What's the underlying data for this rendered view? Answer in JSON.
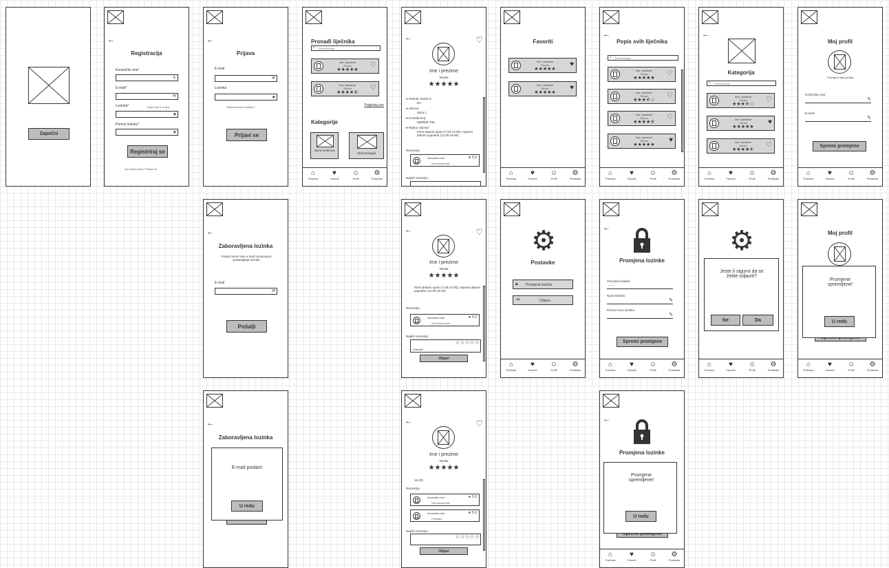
{
  "common": {
    "back": "←",
    "star5": "★★★★★",
    "star45": "★★★★⯪",
    "star35": "★★★⯪☆",
    "emptyStars": "☆☆☆☆☆",
    "heart_outline": "♡",
    "heart_filled": "♥",
    "pencil": "✎",
    "mail": "✉",
    "eye": "👁",
    "user_ic": "♙",
    "search_ic": "🔍",
    "tabs": [
      "Početna",
      "Favoriti",
      "Profil",
      "Postavke"
    ],
    "tab_icons": [
      "⌂",
      "♥",
      "☺",
      "⚙"
    ],
    "doctor_name": "Ime i prezime",
    "specialty": "Struka"
  },
  "s1": {
    "button": "Započni"
  },
  "s2": {
    "title": "Registracija",
    "username_label": "Korisničko ime*",
    "email_label": "E-mail*",
    "password_label": "Lozinka*",
    "password_hint": "Najmanje 8 znaka",
    "repeat_label": "Ponovi lozinku*",
    "button": "Registriraj se",
    "footer": "Već imaš račun? Prijavi se"
  },
  "s3": {
    "title": "Prijava",
    "email_label": "E-mail",
    "password_label": "Lozinka",
    "forgot": "Zaboravio/la si lozinku?",
    "button": "Prijavi se"
  },
  "s4": {
    "title": "Pronađi liječnika",
    "search_ph": "Pretraživanje",
    "see_all": "Pogledaj sve",
    "categories_title": "Kategorije",
    "cat1": "Opća medicina",
    "cat2": "Stomatologija"
  },
  "s5": {
    "b1": "Partner HZZO-a:",
    "b1v": "DA",
    "b2": "Adresa:",
    "b2v": "Ulica 1",
    "b3": "Kontakt broj:",
    "b3v": "053/506-708",
    "b4": "Radno vrijeme:",
    "b4v": "Parni datumi ujutro (7.00-14.00), neparni datumi popodne (14.00-19.00)",
    "reviews": "Recenzije:",
    "r_user": "korisničko ime",
    "r_rating": "5.0",
    "r_text": "Sve preporuke!",
    "write": "Napiši recenziju:"
  },
  "s6": {
    "title": "Favoriti"
  },
  "s7": {
    "title": "Popis svih liječnika",
    "search_ph": "Pretraživanje"
  },
  "s8": {
    "title": "Kategorija",
    "search_ph": "Pretraživanje"
  },
  "s9": {
    "title": "Moj profil",
    "change_photo": "Promijeni sliku profila",
    "username_label": "Korisničko ime:",
    "email_label": "E-mail:",
    "button": "Spremi promjene"
  },
  "s10": {
    "title": "Zaboravljena lozinka",
    "desc": "Poslat ćemo Vam e-mail za ponovno postavljanje lozinke",
    "email_label": "E-mail",
    "button": "Pošalji"
  },
  "s11": {
    "hours": "Parni datumi ujutro (7.00-14.00), neparni datumi popodne (14.00-19.00)",
    "reviews": "Recenzije:",
    "r_user": "korisničko ime",
    "r_rating": "5.0",
    "r_text": "Sve preporuke!",
    "write": "Napiši recenziju:",
    "write_ph": "Pohvale!",
    "post": "Objavi"
  },
  "s12": {
    "title": "Postavke",
    "change_pw": "Promjena lozinke",
    "logout": "Odjava"
  },
  "s13": {
    "title": "Promjena lozinke",
    "current": "Trenutna lozinka:",
    "current_val": "......",
    "new": "Nova lozinka:",
    "repeat": "Ponovi novu lozinku:",
    "button": "Spremi promjene"
  },
  "s14": {
    "question": "Jeste li sigurni da se želite odjaviti?",
    "no": "Ne",
    "yes": "Da"
  },
  "s15": {
    "title": "Moj profil",
    "msg": "Promjene spremljene!",
    "ok": "U redu",
    "under_btn": "Spremi promjene"
  },
  "s16": {
    "title": "Zaboravljena lozinka",
    "msg": "E-mail poslan!",
    "ok": "U redu"
  },
  "s17": {
    "hours_tail": "19.00)",
    "reviews": "Recenzije:",
    "r1_user": "korisničko ime",
    "r1_rating": "5.0",
    "r1_text": "Sve preporuke!",
    "r2_user": "korisničko ime",
    "r2_rating": "5.0",
    "r2_text": "Pohvale!",
    "write": "Napiši recenziju:",
    "post": "Objavi"
  },
  "s18": {
    "title": "Promjena lozinke",
    "msg": "Promjene spremljene!",
    "ok": "U redu",
    "under_btn": "Spremi promjene"
  }
}
